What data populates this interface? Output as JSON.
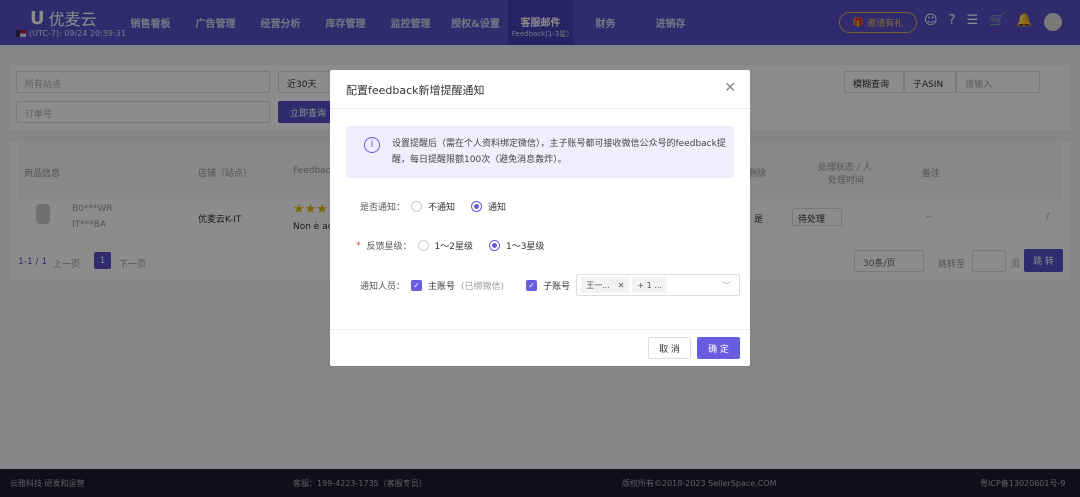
{
  "header": {
    "logo": "优麦云",
    "clock": "(UTC-7): 09/24 20:39:31",
    "nav": [
      "销售看板",
      "广告管理",
      "经营分析",
      "库存管理",
      "监控管理",
      "授权&设置",
      "客服邮件",
      "财务",
      "进销存"
    ],
    "nav_active_sub": "Feedback(1-3星)",
    "invite": "邀请有礼"
  },
  "filters": {
    "site": "所有站点",
    "period": "近30天",
    "order_placeholder": "订单号",
    "search_btn": "立即查询",
    "fuzzy": "模糊查询",
    "asin": "子ASIN",
    "input_placeholder": "请输入"
  },
  "table": {
    "headers": [
      "商品信息",
      "店铺（站点）",
      "Feedback",
      "删除",
      "处理状态 / 人",
      "处理时间",
      "备注"
    ],
    "row": {
      "asin": "B0***WR",
      "sku": "IT***BA",
      "store": "优麦云K-IT",
      "feedback": "Non è ac",
      "deleted": "是",
      "status": "待处理",
      "remark": "--",
      "edit": "/"
    },
    "rating": 3
  },
  "pagination": {
    "range": "1-1 / 1",
    "prev": "上一页",
    "page": "1",
    "next": "下一页",
    "per_page": "30条/页",
    "jump_to": "跳转至",
    "page_unit": "页",
    "jump_btn": "跳 转"
  },
  "footer": {
    "company": "云雅科技 研发和运营",
    "service": "客服：199-4223-1735（客服专员）",
    "copyright": "版权所有©2018-2023 SellerSpace.COM",
    "icp": "粤ICP备13020601号-9"
  },
  "modal": {
    "title": "配置feedback新增提醒通知",
    "info": "设置提醒后（需在个人资料绑定微信），主子账号都可接收微信公众号的feedback提醒，每日提醒限额100次（避免消息轰炸）。",
    "notify_label": "是否通知：",
    "notify_options": [
      "不通知",
      "通知"
    ],
    "notify_selected": "通知",
    "level_label": "反馈星级：",
    "level_options": [
      "1～2星级",
      "1～3星级"
    ],
    "level_selected": "1～3星级",
    "people_label": "通知人员：",
    "main_account": "主账号",
    "main_note": "(已绑微信)",
    "sub_account": "子账号",
    "sub_tags": [
      "王一...",
      "+ 1 ..."
    ],
    "cancel": "取 消",
    "confirm": "确 定"
  }
}
